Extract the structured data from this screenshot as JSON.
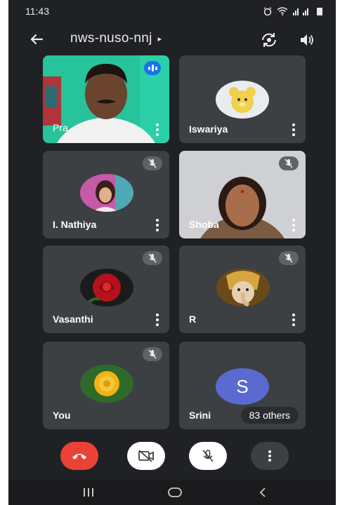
{
  "status_bar": {
    "time": "11:43"
  },
  "app_bar": {
    "meeting_code": "nws-nuso-nnj",
    "caret": "▸"
  },
  "participants": [
    {
      "name": "Pra",
      "state": "speaking"
    },
    {
      "name": "Iswariya",
      "state": "unmuted"
    },
    {
      "name": "I. Nathiya",
      "state": "muted"
    },
    {
      "name": "Shoba",
      "state": "muted"
    },
    {
      "name": "Vasanthi",
      "state": "muted"
    },
    {
      "name": "R",
      "state": "muted"
    },
    {
      "name": "You",
      "state": "muted"
    },
    {
      "name": "Srini",
      "avatar_letter": "S",
      "overflow_label": "83 others"
    }
  ],
  "colors": {
    "background": "#202124",
    "tile": "#3c4043",
    "end_call": "#ea4335",
    "accent": "#1a73e8",
    "avatar": "#5b6ad0"
  },
  "icons": [
    "back-arrow-icon",
    "switch-camera-icon",
    "speaker-icon",
    "mic-off-icon",
    "more-vert-icon",
    "end-call-icon",
    "camera-off-icon"
  ]
}
